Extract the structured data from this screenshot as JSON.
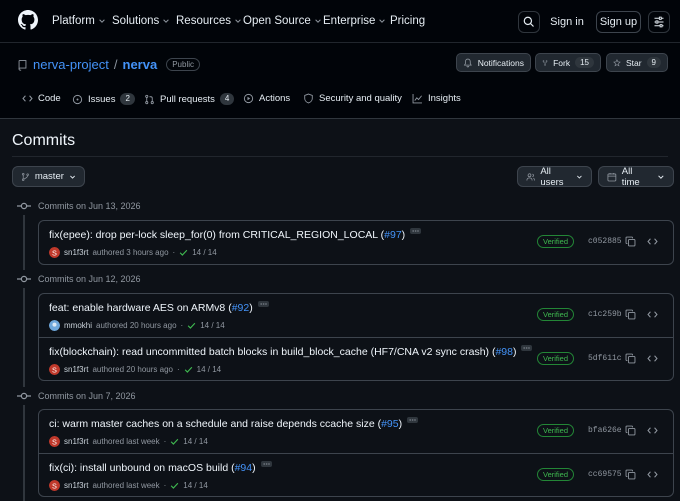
{
  "topnav": {
    "items": [
      "Platform",
      "Solutions",
      "Resources",
      "Open Source",
      "Enterprise",
      "Pricing"
    ],
    "sign_in": "Sign in",
    "sign_up": "Sign up"
  },
  "repo": {
    "owner": "nerva-project",
    "separator": "/",
    "name": "nerva",
    "visibility": "Public",
    "notifications_label": "Notifications",
    "fork_label": "Fork",
    "fork_count": "15",
    "star_label": "Star",
    "star_count": "9"
  },
  "tabs": [
    {
      "label": "Code",
      "icon": "code-icon"
    },
    {
      "label": "Issues",
      "count": "2",
      "icon": "issue-icon"
    },
    {
      "label": "Pull requests",
      "count": "4",
      "icon": "pull-request-icon"
    },
    {
      "label": "Actions",
      "icon": "play-icon"
    },
    {
      "label": "Security and quality",
      "icon": "shield-icon"
    },
    {
      "label": "Insights",
      "icon": "graph-icon"
    }
  ],
  "page": {
    "title": "Commits",
    "branch": "master",
    "users_filter": "All users",
    "time_filter": "All time"
  },
  "groups": [
    {
      "date": "Commits on Jun 13, 2026",
      "commits": [
        {
          "message": "fix(epee): drop per-lock sleep_for(0) from CRITICAL_REGION_LOCAL (",
          "pr": "#97",
          "close": ")",
          "author": "sn1f3rt",
          "time": "authored 3 hours ago",
          "checks": "14 / 14",
          "verified": "Verified",
          "sha": "c052885"
        }
      ]
    },
    {
      "date": "Commits on Jun 12, 2026",
      "commits": [
        {
          "message": "feat: enable hardware AES on ARMv8 (",
          "pr": "#92",
          "close": ")",
          "author": "mmokhi",
          "time": "authored 20 hours ago",
          "checks": "14 / 14",
          "verified": "Verified",
          "sha": "c1c259b"
        },
        {
          "message": "fix(blockchain): read uncommitted batch blocks in build_block_cache (HF7/CNA v2 sync crash) (",
          "pr": "#98",
          "close": ")",
          "author": "sn1f3rt",
          "time": "authored 20 hours ago",
          "checks": "14 / 14",
          "verified": "Verified",
          "sha": "5df611c"
        }
      ]
    },
    {
      "date": "Commits on Jun 7, 2026",
      "commits": [
        {
          "message": "ci: warm master caches on a schedule and raise depends ccache size (",
          "pr": "#95",
          "close": ")",
          "author": "sn1f3rt",
          "time": "authored last week",
          "checks": "14 / 14",
          "verified": "Verified",
          "sha": "bfa626e"
        },
        {
          "message": "fix(ci): install unbound on macOS build (",
          "pr": "#94",
          "close": ")",
          "author": "sn1f3rt",
          "time": "authored last week",
          "checks": "14 / 14",
          "verified": "Verified",
          "sha": "cc69575"
        }
      ]
    }
  ],
  "colors": {
    "background": "#0d1117",
    "header": "#010409",
    "link": "#4493f8",
    "verified": "#3fb950",
    "border": "#3d444d"
  }
}
